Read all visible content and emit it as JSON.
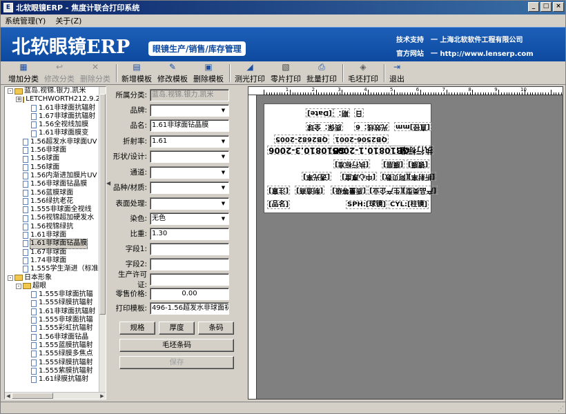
{
  "window": {
    "title": "北软眼镜ERP - 焦度计联合打印系统",
    "minimize": "_",
    "restore": "□",
    "close": "×"
  },
  "menu": {
    "items": [
      "系统管理(Y)",
      "关于(Z)"
    ]
  },
  "banner": {
    "logo": "北软眼镜ERP",
    "slogan": "眼镜生产/销售/库存管理",
    "support_label": "技术支持",
    "support_value": "一 上海北软软件工程有限公司",
    "site_label": "官方网站",
    "site_value": "一 http://www.lenserp.com"
  },
  "toolbar": {
    "add_category": "增加分类",
    "edit_category": "修改分类",
    "delete_category": "删除分类",
    "new_template": "新增模板",
    "edit_template": "修改模板",
    "delete_template": "删除模板",
    "photometric_print": "测光打印",
    "retail_print": "零片打印",
    "batch_print": "批量打印",
    "blank_print": "毛坯打印",
    "exit": "退出"
  },
  "tree": {
    "items": [
      {
        "level": 0,
        "type": "folder",
        "expander": "-",
        "label": "蓝岛.视锦.银力.凯米"
      },
      {
        "level": 1,
        "type": "folder",
        "expander": "+",
        "label": "LETCHWORTH212.9.2"
      },
      {
        "level": 2,
        "type": "doc",
        "label": "1.61非球面抗辐射"
      },
      {
        "level": 2,
        "type": "doc",
        "label": "1.67非球面抗辐射"
      },
      {
        "level": 2,
        "type": "doc",
        "label": "1.56全视线加膜"
      },
      {
        "level": 2,
        "type": "doc",
        "label": "1.61非球面膜变"
      },
      {
        "level": 1,
        "type": "doc",
        "label": "1.56超发水非球面UV"
      },
      {
        "level": 1,
        "type": "doc",
        "label": "1.56非球面"
      },
      {
        "level": 1,
        "type": "doc",
        "label": "1.56球面"
      },
      {
        "level": 1,
        "type": "doc",
        "label": "1.56球面"
      },
      {
        "level": 1,
        "type": "doc",
        "label": "1.56内渐进加膜片UV"
      },
      {
        "level": 1,
        "type": "doc",
        "label": "1.56非球面钻晶膜"
      },
      {
        "level": 1,
        "type": "doc",
        "label": "1.56蓝膜球面"
      },
      {
        "level": 1,
        "type": "doc",
        "label": "1.56绿抗老花"
      },
      {
        "level": 1,
        "type": "doc",
        "label": "1.555非球面全视线"
      },
      {
        "level": 1,
        "type": "doc",
        "label": "1.56视锦超加硬发水"
      },
      {
        "level": 1,
        "type": "doc",
        "label": "1.56视锦绿抗"
      },
      {
        "level": 1,
        "type": "doc",
        "label": "1.61非球面"
      },
      {
        "level": 1,
        "type": "doc",
        "label": "1.61非球面钻晶膜",
        "selected": true
      },
      {
        "level": 1,
        "type": "doc",
        "label": "1.67非球面"
      },
      {
        "level": 1,
        "type": "doc",
        "label": "1.74非球面"
      },
      {
        "level": 1,
        "type": "doc",
        "label": "1.555学生渐进（标准"
      },
      {
        "level": 0,
        "type": "folder",
        "expander": "-",
        "label": "日本形象"
      },
      {
        "level": 1,
        "type": "folder",
        "expander": "-",
        "label": "超眼"
      },
      {
        "level": 2,
        "type": "doc",
        "label": "1.555非球面抗辐"
      },
      {
        "level": 2,
        "type": "doc",
        "label": "1.555绿膜抗辐射"
      },
      {
        "level": 2,
        "type": "doc",
        "label": "1.61非球面抗辐射"
      },
      {
        "level": 2,
        "type": "doc",
        "label": "1.555非球面抗辐"
      },
      {
        "level": 2,
        "type": "doc",
        "label": "1.555彩虹抗辐射"
      },
      {
        "level": 2,
        "type": "doc",
        "label": "1.56非球面钻晶"
      },
      {
        "level": 2,
        "type": "doc",
        "label": "1.555蓝膜抗辐射"
      },
      {
        "level": 2,
        "type": "doc",
        "label": "1.555绿膜多焦点"
      },
      {
        "level": 2,
        "type": "doc",
        "label": "1.555绿膜抗辐射"
      },
      {
        "level": 2,
        "type": "doc",
        "label": "1.555紫膜抗辐射"
      },
      {
        "level": 2,
        "type": "doc",
        "label": "1.61绿膜抗辐射"
      }
    ]
  },
  "form": {
    "category": {
      "label": "所属分类:",
      "value": "蓝岛.视锦.银力.凯米"
    },
    "brand": {
      "label": "品牌:",
      "value": ""
    },
    "product_name": {
      "label": "品名:",
      "value": "1.61非球面钻晶膜"
    },
    "refractive_index": {
      "label": "折射率:",
      "value": "1.61"
    },
    "shape": {
      "label": "形状/设计:",
      "value": ""
    },
    "channel": {
      "label": "通道:",
      "value": ""
    },
    "material": {
      "label": "品种/材质:",
      "value": ""
    },
    "surface": {
      "label": "表面处理:",
      "value": ""
    },
    "dye": {
      "label": "染色:",
      "value": "无色"
    },
    "gravity": {
      "label": "比重:",
      "value": "1.30"
    },
    "field1": {
      "label": "字段1:",
      "value": ""
    },
    "field2": {
      "label": "字段2:",
      "value": ""
    },
    "license": {
      "label": "生产许可证:",
      "value": ""
    },
    "retail_price": {
      "label": "零售价格:",
      "value": "0.00"
    },
    "print_template": {
      "label": "打印模板:",
      "value": "496-1.56超发水非球面初 ..."
    },
    "spec_button": "规格",
    "thickness_button": "厚度",
    "barcode_button": "条码",
    "blank_barcode_button": "毛坯条码",
    "save_button": "保存"
  },
  "ruler": {
    "numbers": [
      "1",
      "2",
      "3",
      "4",
      "5",
      "6",
      "7",
      "8",
      "9",
      "10"
    ]
  },
  "label_preview": {
    "date": "[Date]",
    "ph": "日",
    "period": "期：",
    "warranty": "质保：全球",
    "visible": "光效线：6",
    "lens_label": "[镜片类型]",
    "std1": "GB10810.1-2005",
    "std2": "GB10810.3-2006",
    "std3": "QB2506-2001",
    "std4": "QB2682-2005",
    "exec_std": "执行标准：",
    "diameter": "[直径]mm",
    "exec_std2": "[执行标准]",
    "coating": "[膜层]",
    "film": "[镀膜]",
    "refr": "[折射率]",
    "abbe": "[阿贝数]",
    "center": "[中心厚度]",
    "transmit": "[透光率]",
    "item1": "[说明]",
    "item2": "[生产企业]",
    "item3": "[质量等级]",
    "item4": "[产品类型]",
    "name": "[品名]",
    "sph": "SPH:[球镜]",
    "cyl": "CYL:[柱镜]",
    "note": "[注意]",
    "mfg": "[制造商]"
  }
}
